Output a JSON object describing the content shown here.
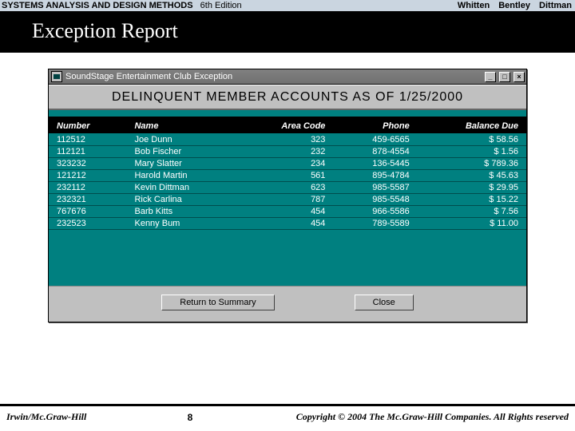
{
  "top": {
    "book_title": "SYSTEMS ANALYSIS AND DESIGN METHODS",
    "edition": "6th Edition",
    "authors": [
      "Whitten",
      "Bentley",
      "Dittman"
    ]
  },
  "slide_title": "Exception Report",
  "dialog": {
    "title": "SoundStage Entertainment Club Exception",
    "report_heading": "DELINQUENT MEMBER ACCOUNTS AS OF 1/25/2000",
    "columns": [
      "Number",
      "Name",
      "Area Code",
      "Phone",
      "Balance Due"
    ],
    "rows": [
      {
        "number": "112512",
        "name": "Joe Dunn",
        "area": "323",
        "phone": "459-6565",
        "balance": "$ 58.56"
      },
      {
        "number": "112121",
        "name": "Bob Fischer",
        "area": "232",
        "phone": "878-4554",
        "balance": "$ 1.56"
      },
      {
        "number": "323232",
        "name": "Mary Slatter",
        "area": "234",
        "phone": "136-5445",
        "balance": "$ 789.36"
      },
      {
        "number": "121212",
        "name": "Harold Martin",
        "area": "561",
        "phone": "895-4784",
        "balance": "$ 45.63"
      },
      {
        "number": "232112",
        "name": "Kevin Dittman",
        "area": "623",
        "phone": "985-5587",
        "balance": "$ 29.95"
      },
      {
        "number": "232321",
        "name": "Rick Carlina",
        "area": "787",
        "phone": "985-5548",
        "balance": "$ 15.22"
      },
      {
        "number": "767676",
        "name": "Barb Kitts",
        "area": "454",
        "phone": "966-5586",
        "balance": "$ 7.56"
      },
      {
        "number": "232523",
        "name": "Kenny Bum",
        "area": "454",
        "phone": "789-5589",
        "balance": "$ 11.00"
      }
    ],
    "buttons": {
      "return": "Return to Summary",
      "close": "Close"
    },
    "win_controls": {
      "min": "_",
      "max": "□",
      "close": "×"
    }
  },
  "footer": {
    "publisher": "Irwin/Mc.Graw-Hill",
    "page": "8",
    "copyright": "Copyright © 2004 The Mc.Graw-Hill Companies. All Rights reserved"
  }
}
